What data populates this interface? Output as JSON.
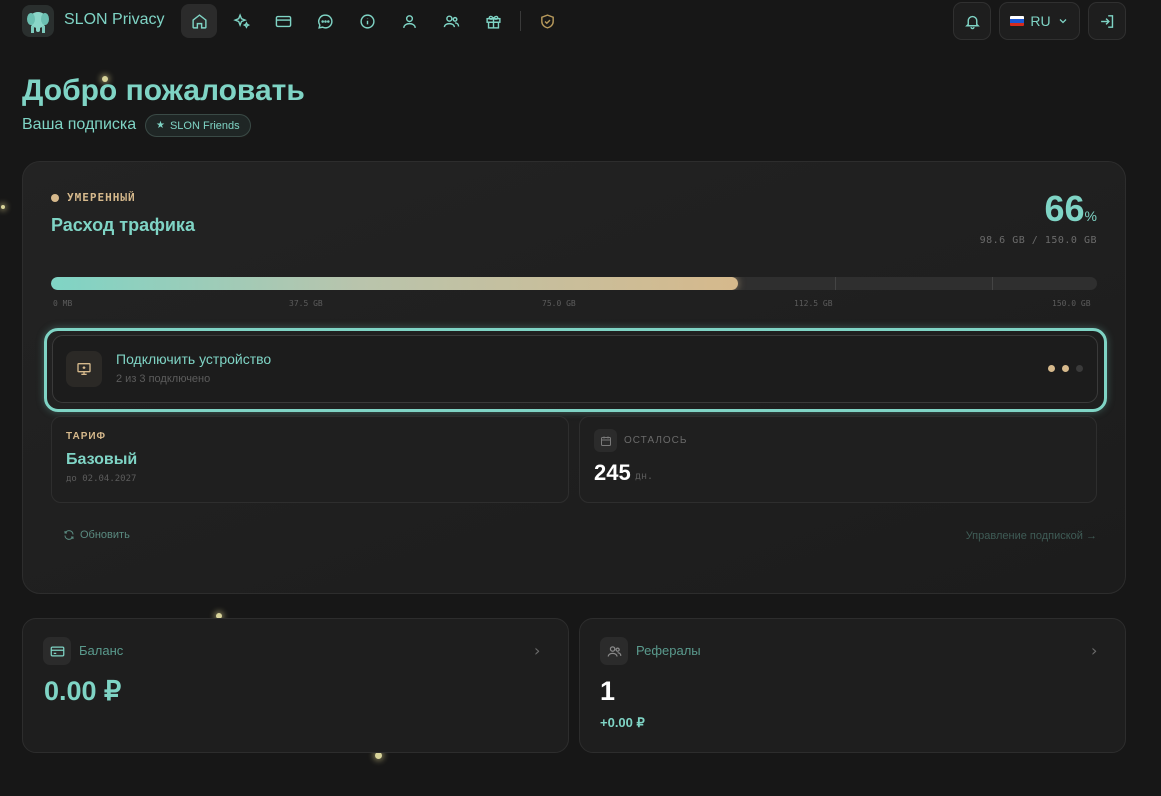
{
  "app": {
    "brand": "SLON Privacy"
  },
  "nav": {
    "items": [
      {
        "name": "home",
        "icon": "home-icon",
        "active": true
      },
      {
        "name": "features",
        "icon": "sparkles-icon"
      },
      {
        "name": "payments",
        "icon": "credit-card-icon"
      },
      {
        "name": "chat",
        "icon": "chat-icon"
      },
      {
        "name": "info",
        "icon": "info-icon"
      },
      {
        "name": "profile",
        "icon": "user-icon"
      },
      {
        "name": "referrals",
        "icon": "users-icon"
      },
      {
        "name": "gifts",
        "icon": "gift-icon"
      },
      {
        "name": "security",
        "icon": "shield-check-icon"
      }
    ],
    "language": "RU"
  },
  "header": {
    "title": "Добро пожаловать",
    "subscription_label": "Ваша подписка",
    "plan_badge": "SLON Friends"
  },
  "traffic": {
    "status": "УМЕРЕННЫЙ",
    "title": "Расход трафика",
    "percent": "66",
    "percent_sign": "%",
    "usage": "98.6 GB / 150.0 GB",
    "fill_fraction": 0.657,
    "ticks": [
      "0 MB",
      "37.5 GB",
      "75.0 GB",
      "112.5 GB",
      "150.0 GB"
    ]
  },
  "device": {
    "title": "Подключить устройство",
    "subtitle": "2 из 3 подключено",
    "connected": 2,
    "total": 3
  },
  "tariff": {
    "label": "ТАРИФ",
    "name": "Базовый",
    "until": "до 02.04.2027"
  },
  "remaining": {
    "label": "ОСТАЛОСЬ",
    "days": "245",
    "unit": "дн."
  },
  "actions": {
    "refresh": "Обновить",
    "manage": "Управление подпиской →"
  },
  "balance": {
    "label": "Баланс",
    "value": "0.00 ₽"
  },
  "referrals": {
    "label": "Рефералы",
    "count": "1",
    "earnings": "+0.00 ₽"
  },
  "colors": {
    "accent": "#7fd4c5",
    "gold": "#d6b98c",
    "background": "#171717"
  }
}
